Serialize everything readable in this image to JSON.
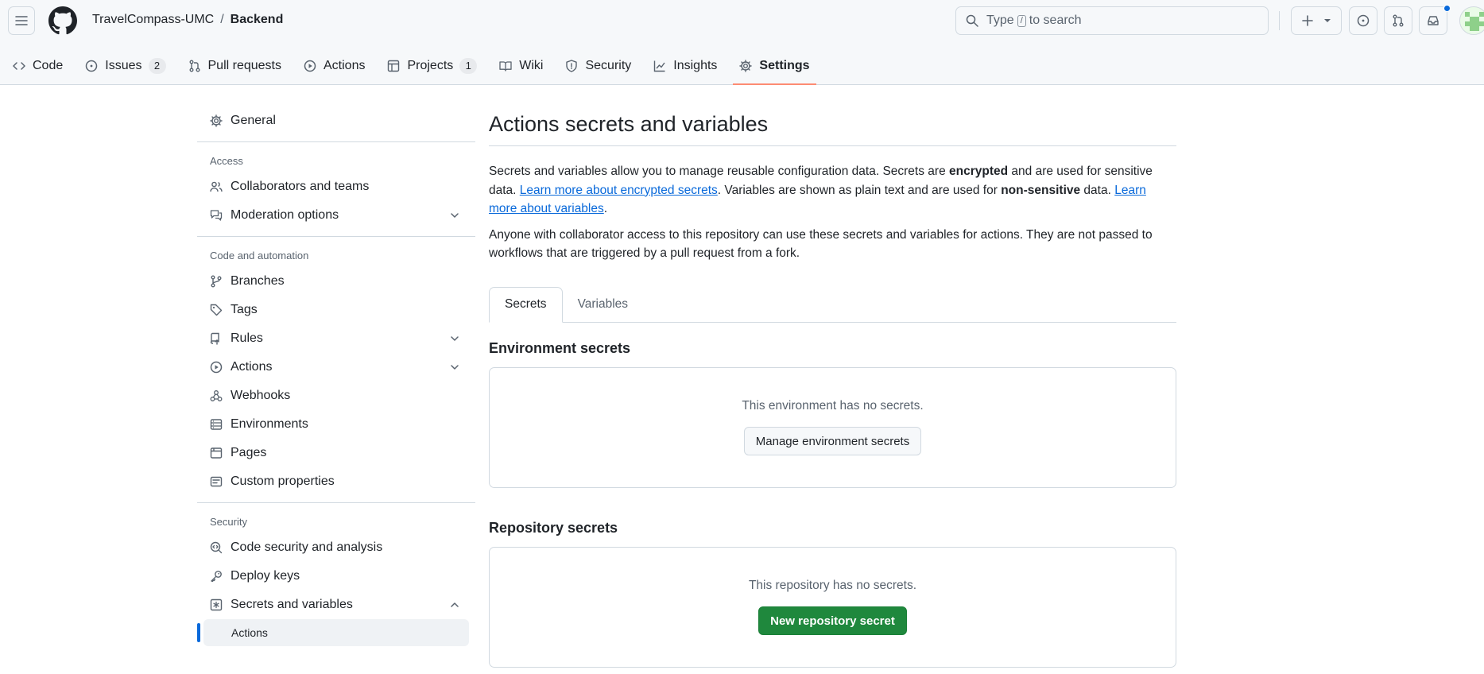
{
  "header": {
    "owner": "TravelCompass-UMC",
    "separator": "/",
    "repo": "Backend",
    "search_before": "Type",
    "search_key": "/",
    "search_after": "to search"
  },
  "nav": {
    "tabs": [
      {
        "label": "Code"
      },
      {
        "label": "Issues",
        "count": "2"
      },
      {
        "label": "Pull requests"
      },
      {
        "label": "Actions"
      },
      {
        "label": "Projects",
        "count": "1"
      },
      {
        "label": "Wiki"
      },
      {
        "label": "Security"
      },
      {
        "label": "Insights"
      },
      {
        "label": "Settings"
      }
    ]
  },
  "sidebar": {
    "general": "General",
    "access_heading": "Access",
    "access_items": [
      "Collaborators and teams",
      "Moderation options"
    ],
    "code_heading": "Code and automation",
    "code_items": [
      "Branches",
      "Tags",
      "Rules",
      "Actions",
      "Webhooks",
      "Environments",
      "Pages",
      "Custom properties"
    ],
    "security_heading": "Security",
    "security_items": [
      "Code security and analysis",
      "Deploy keys",
      "Secrets and variables"
    ],
    "sub_item": "Actions"
  },
  "main": {
    "title": "Actions secrets and variables",
    "desc": {
      "p1": "Secrets and variables allow you to manage reusable configuration data. Secrets are ",
      "b1": "encrypted",
      "p2": " and are used for sensitive data. ",
      "link1": "Learn more about encrypted secrets",
      "p3": ". Variables are shown as plain text and are used for ",
      "b2": "non-sensitive",
      "p4": " data. ",
      "link2": "Learn more about variables",
      "p5": "."
    },
    "desc2": "Anyone with collaborator access to this repository can use these secrets and variables for actions. They are not passed to workflows that are triggered by a pull request from a fork.",
    "tabs": [
      "Secrets",
      "Variables"
    ],
    "env": {
      "title": "Environment secrets",
      "empty": "This environment has no secrets.",
      "button": "Manage environment secrets"
    },
    "repo": {
      "title": "Repository secrets",
      "empty": "This repository has no secrets.",
      "button": "New repository secret"
    }
  },
  "colors": {
    "accent": "#0969da",
    "primary_button": "#1f883d",
    "selected_tab_underline": "#fd8c73"
  },
  "icons": {
    "menu": "hamburger-icon",
    "logo": "github-logo-icon",
    "search": "search-icon",
    "create": "plus-icon",
    "issues": "issue-opened-icon",
    "pulls": "git-pull-request-icon",
    "inbox": "inbox-icon"
  }
}
